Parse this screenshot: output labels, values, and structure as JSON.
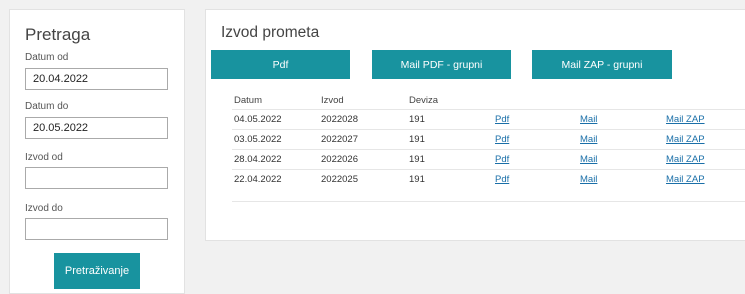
{
  "search": {
    "title": "Pretraga",
    "date_from_label": "Datum od",
    "date_from_value": "20.04.2022",
    "date_to_label": "Datum do",
    "date_to_value": "20.05.2022",
    "statement_from_label": "Izvod od",
    "statement_from_value": "",
    "statement_to_label": "Izvod do",
    "statement_to_value": "",
    "button_label": "Pretraživanje"
  },
  "statement": {
    "title": "Izvod prometa",
    "buttons": {
      "pdf": "Pdf",
      "mail_pdf_group": "Mail PDF - grupni",
      "mail_zap_group": "Mail ZAP - grupni"
    },
    "columns": [
      "Datum",
      "Izvod",
      "Deviza"
    ],
    "rows": [
      {
        "date": "04.05.2022",
        "number": "2022028",
        "currency": "191",
        "pdf": "Pdf",
        "mail": "Mail",
        "mail_zap": "Mail ZAP"
      },
      {
        "date": "03.05.2022",
        "number": "2022027",
        "currency": "191",
        "pdf": "Pdf",
        "mail": "Mail",
        "mail_zap": "Mail ZAP"
      },
      {
        "date": "28.04.2022",
        "number": "2022026",
        "currency": "191",
        "pdf": "Pdf",
        "mail": "Mail",
        "mail_zap": "Mail ZAP"
      },
      {
        "date": "22.04.2022",
        "number": "2022025",
        "currency": "191",
        "pdf": "Pdf",
        "mail": "Mail",
        "mail_zap": "Mail ZAP"
      }
    ]
  },
  "colors": {
    "accent": "#18939f",
    "link": "#1a6fa8"
  }
}
